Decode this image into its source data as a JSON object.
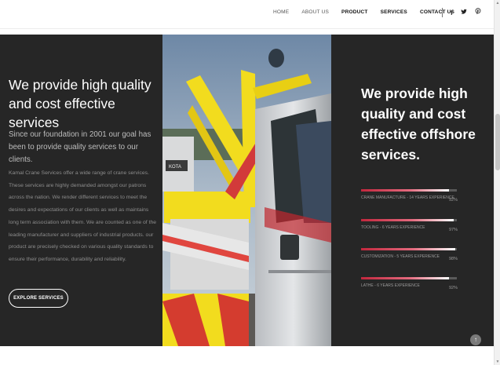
{
  "nav": {
    "items": [
      {
        "label": "HOME"
      },
      {
        "label": "ABOUT US"
      },
      {
        "label": "PRODUCT"
      },
      {
        "label": "SERVICES"
      },
      {
        "label": "CONTACT US"
      }
    ],
    "social": [
      "f",
      "𝕥",
      "⌗"
    ],
    "social_icons": [
      "facebook-icon",
      "twitter-icon",
      "pinterest-icon"
    ]
  },
  "left": {
    "title": "We provide high quality and cost effective services",
    "subtitle": "Since our foundation in 2001 our goal has been to provide quality services to our clients.",
    "body": "Kamal Crane Services offer a wide range of crane services. These services are highly demanded amongst our patrons across the nation. We render different services to meet the desires and expectations of our clients as well as maintains long term association with them. We are counted as one of the leading manufacturer and suppliers of industrial products. our product are precisely checked on various quality standards to ensure their performance, durability and reliability.",
    "button": "EXPLORE SERVICES"
  },
  "right": {
    "title": "We provide high quality and cost effective offshore services.",
    "skills": [
      {
        "label": "CRANE MANUFACTURE - 14 YEARS EXPERIENCE",
        "percent": 92,
        "percent_text": "92%"
      },
      {
        "label": "TOOLING - 6 YEARS EXPERIENCE",
        "percent": 97,
        "percent_text": "97%"
      },
      {
        "label": "CUSTOMIZATION - 5 YEARS EXPERIENCE",
        "percent": 98,
        "percent_text": "98%"
      },
      {
        "label": "LATHE - 6 YEARS EXPERIENCE",
        "percent": 92,
        "percent_text": "92%"
      }
    ]
  },
  "photo": {
    "truck_text": "KOTA"
  },
  "colors": {
    "panel_bg": "#262626",
    "accent": "#c2273d",
    "crane_yellow": "#f2dc1e"
  }
}
